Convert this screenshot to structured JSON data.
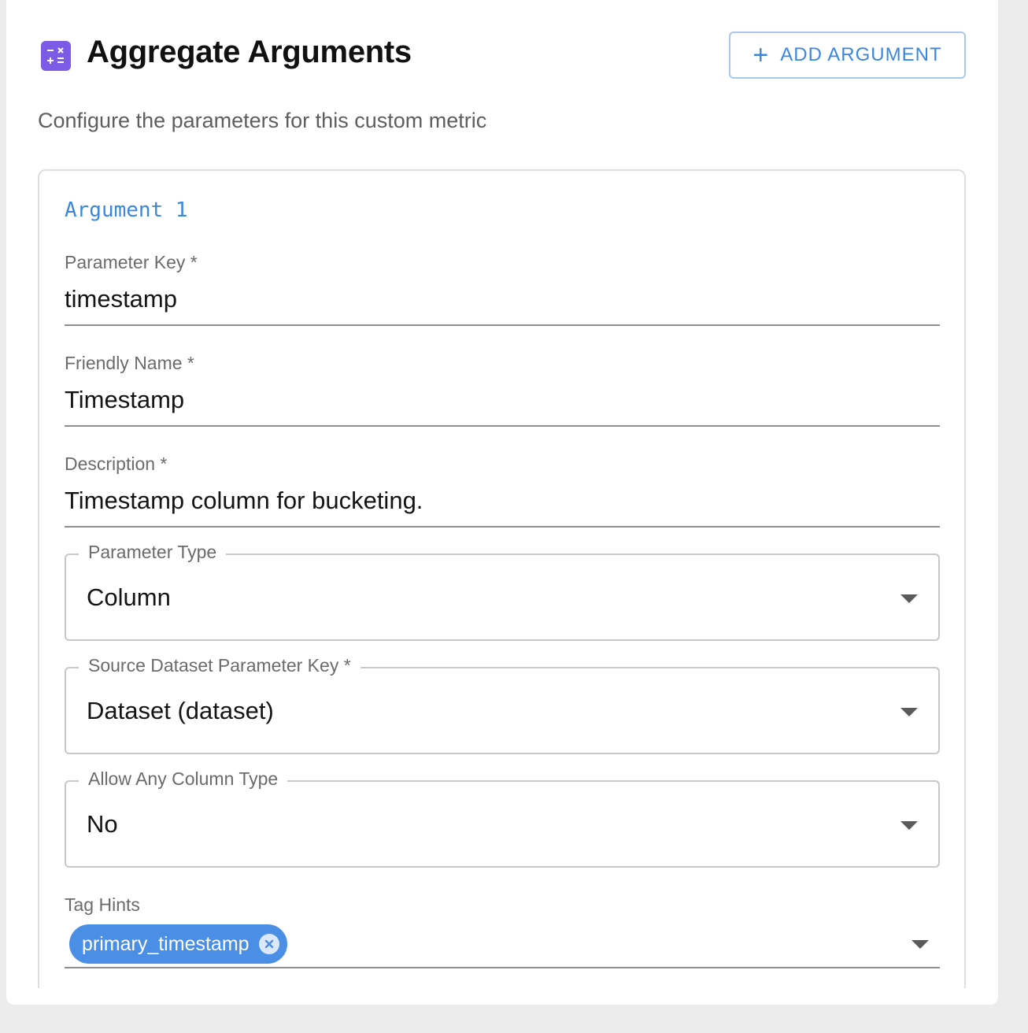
{
  "header": {
    "title": "Aggregate Arguments",
    "icon": "calculator-icon",
    "subtitle": "Configure the parameters for this custom metric",
    "add_button_label": "ADD ARGUMENT",
    "add_button_icon": "plus-icon"
  },
  "argument": {
    "title": "Argument 1",
    "parameter_key": {
      "label": "Parameter Key *",
      "value": "timestamp"
    },
    "friendly_name": {
      "label": "Friendly Name *",
      "value": "Timestamp"
    },
    "description": {
      "label": "Description *",
      "value": "Timestamp column for bucketing."
    },
    "parameter_type": {
      "label": "Parameter Type",
      "value": "Column"
    },
    "source_dataset": {
      "label": "Source Dataset Parameter Key *",
      "value": "Dataset (dataset)"
    },
    "allow_any_column_type": {
      "label": "Allow Any Column Type",
      "value": "No"
    },
    "tag_hints": {
      "label": "Tag Hints",
      "chips": [
        "primary_timestamp"
      ]
    }
  },
  "colors": {
    "accent": "#3b87e0",
    "icon_bg": "#7c5ce6",
    "chip_bg": "#4b8ee6"
  }
}
